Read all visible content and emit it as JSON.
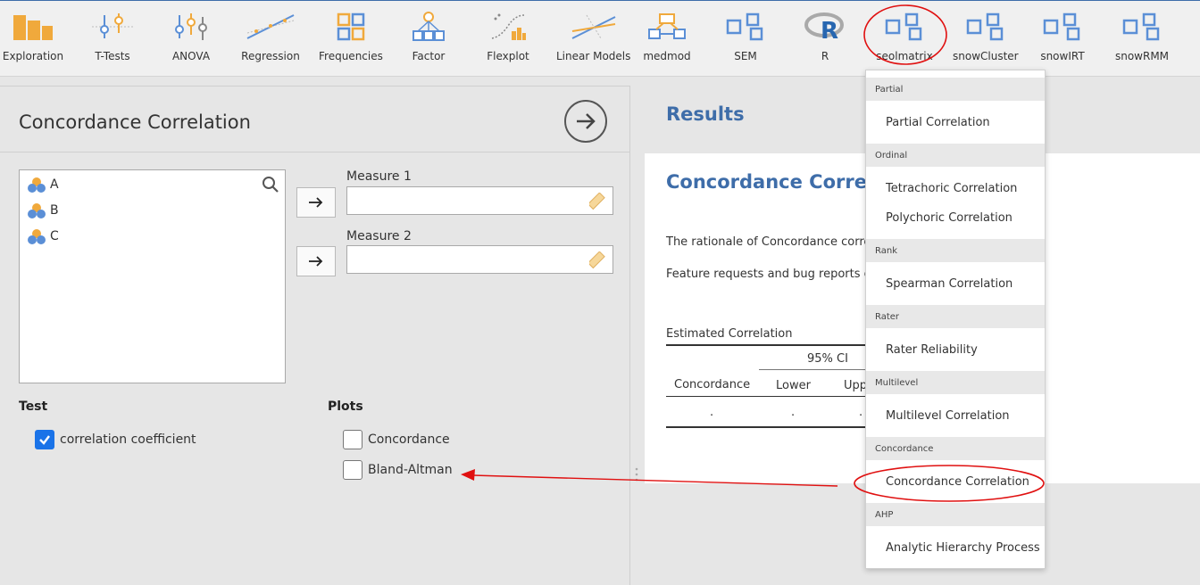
{
  "ribbon": {
    "items": [
      {
        "label": "Exploration",
        "icon": "exploration-icon"
      },
      {
        "label": "T-Tests",
        "icon": "t-tests-icon"
      },
      {
        "label": "ANOVA",
        "icon": "anova-icon"
      },
      {
        "label": "Regression",
        "icon": "regression-icon"
      },
      {
        "label": "Frequencies",
        "icon": "frequencies-icon"
      },
      {
        "label": "Factor",
        "icon": "factor-icon"
      },
      {
        "label": "Flexplot",
        "icon": "flexplot-icon"
      },
      {
        "label": "Linear Models",
        "icon": "linear-models-icon"
      },
      {
        "label": "medmod",
        "icon": "medmod-icon"
      },
      {
        "label": "SEM",
        "icon": "module-icon"
      },
      {
        "label": "R",
        "icon": "r-icon"
      },
      {
        "label": "seolmatrix",
        "icon": "module-icon"
      },
      {
        "label": "snowCluster",
        "icon": "module-icon"
      },
      {
        "label": "snowIRT",
        "icon": "module-icon"
      },
      {
        "label": "snowRMM",
        "icon": "module-icon"
      }
    ]
  },
  "analysis": {
    "title": "Concordance Correlation",
    "variables": [
      "A",
      "B",
      "C"
    ],
    "measure1_label": "Measure 1",
    "measure2_label": "Measure 2",
    "test_title": "Test",
    "test_options": [
      {
        "label": "correlation coefficient",
        "checked": true
      }
    ],
    "plots_title": "Plots",
    "plot_options": [
      {
        "label": "Concordance",
        "checked": false
      },
      {
        "label": "Bland-Altman",
        "checked": false
      }
    ]
  },
  "results": {
    "header": "Results",
    "title": "Concordance Correla",
    "text1": "The rationale of Concordance corre",
    "text2": "Feature requests and bug reports c",
    "table": {
      "caption": "Estimated Correlation",
      "ci_header": "95% CI",
      "col_concordance": "Concordance",
      "col_lower": "Lower",
      "col_upper": "Upp",
      "row_concordance": ".",
      "row_lower": ".",
      "row_upper": "."
    }
  },
  "menu": {
    "sections": [
      {
        "title": "Partial",
        "items": [
          "Partial Correlation"
        ]
      },
      {
        "title": "Ordinal",
        "items": [
          "Tetrachoric Correlation",
          "Polychoric Correlation"
        ]
      },
      {
        "title": "Rank",
        "items": [
          "Spearman Correlation"
        ]
      },
      {
        "title": "Rater",
        "items": [
          "Rater Reliability"
        ]
      },
      {
        "title": "Multilevel",
        "items": [
          "Multilevel Correlation"
        ]
      },
      {
        "title": "Concordance",
        "items": [
          "Concordance Correlation"
        ]
      },
      {
        "title": "AHP",
        "items": [
          "Analytic Hierarchy Process"
        ]
      }
    ]
  },
  "colors": {
    "accent": "#3e6da9",
    "annotation": "#e01010",
    "check": "#1a73e8",
    "icon_orange": "#f0a93c",
    "icon_blue": "#5b8fd6"
  }
}
